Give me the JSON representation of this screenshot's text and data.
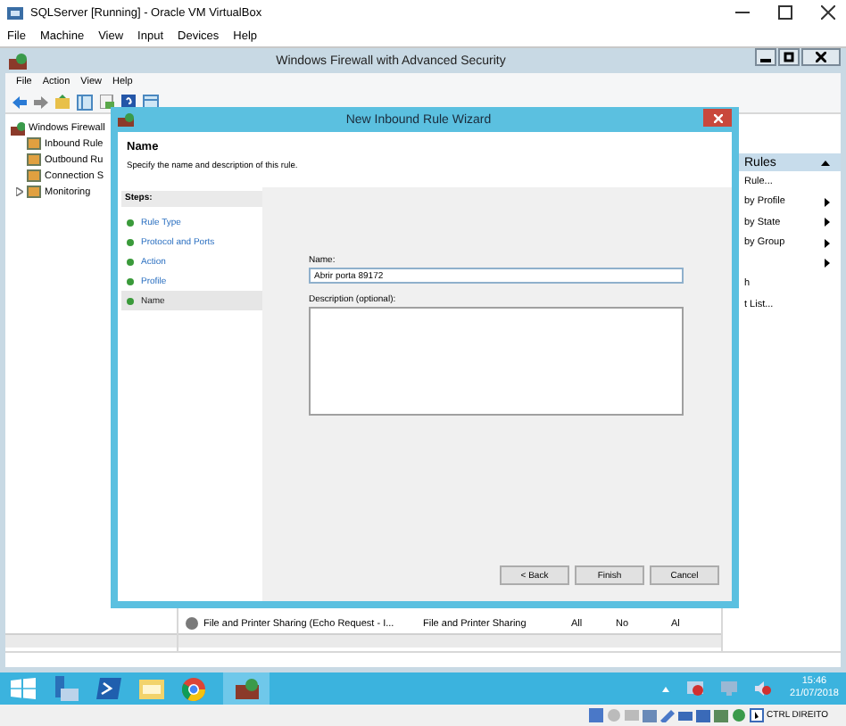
{
  "vbox_window": {
    "title": "SQLServer [Running] - Oracle VM VirtualBox",
    "menu": [
      "File",
      "Machine",
      "View",
      "Input",
      "Devices",
      "Help"
    ]
  },
  "mmc_window": {
    "title": "Windows Firewall with Advanced Security",
    "menu": [
      "File",
      "Action",
      "View",
      "Help"
    ],
    "tree": {
      "label": "Windows Firewall",
      "children": [
        {
          "label": "Inbound Rule",
          "collapsed": false
        },
        {
          "label": "Outbound Ru",
          "collapsed": false
        },
        {
          "label": "Connection S",
          "collapsed": false
        },
        {
          "label": "Monitoring",
          "collapsed": true
        }
      ]
    },
    "rules_row": [
      "File and Printer Sharing (Echo Request - I...",
      "File and Printer Sharing",
      "All",
      "No",
      "Al"
    ],
    "actions": {
      "header": "Rules",
      "items": [
        {
          "label": "Rule...",
          "submenu": false
        },
        {
          "label": "by Profile",
          "submenu": true
        },
        {
          "label": "by State",
          "submenu": true
        },
        {
          "label": "by Group",
          "submenu": true
        },
        {
          "submenu": true
        },
        {
          "label": "h",
          "submenu": false
        },
        {
          "label": "t List...",
          "submenu": false
        }
      ]
    }
  },
  "wizard": {
    "title": "New Inbound Rule Wizard",
    "heading": "Name",
    "subheading": "Specify the name and description of this rule.",
    "steps_title": "Steps:",
    "steps": [
      {
        "label": "Rule Type",
        "selected": false
      },
      {
        "label": "Protocol and Ports",
        "selected": false
      },
      {
        "label": "Action",
        "selected": false
      },
      {
        "label": "Profile",
        "selected": false
      },
      {
        "label": "Name",
        "selected": true
      }
    ],
    "name_label": "Name:",
    "name_value": "Abrir porta 89172",
    "description_label": "Description (optional):",
    "buttons": [
      "< Back",
      "Finish",
      "Cancel"
    ]
  },
  "taskbar": {
    "time": "15:46",
    "date": "21/07/2018"
  },
  "vbox_status": {
    "host_key": "CTRL DIREITO"
  }
}
